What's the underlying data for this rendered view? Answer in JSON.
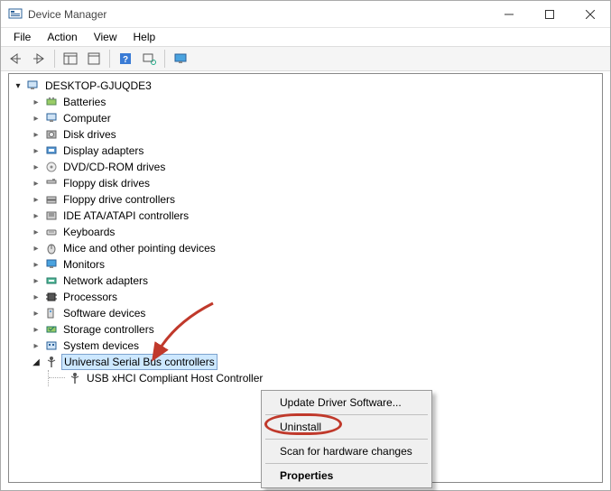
{
  "window": {
    "title": "Device Manager"
  },
  "menubar": [
    "File",
    "Action",
    "View",
    "Help"
  ],
  "tree": {
    "root": "DESKTOP-GJUQDE3",
    "categories": [
      "Batteries",
      "Computer",
      "Disk drives",
      "Display adapters",
      "DVD/CD-ROM drives",
      "Floppy disk drives",
      "Floppy drive controllers",
      "IDE ATA/ATAPI controllers",
      "Keyboards",
      "Mice and other pointing devices",
      "Monitors",
      "Network adapters",
      "Processors",
      "Software devices",
      "Storage controllers",
      "System devices"
    ],
    "selected_category": "Universal Serial Bus controllers",
    "selected_child": "USB xHCI Compliant Host Controller"
  },
  "context_menu": {
    "update": "Update Driver Software...",
    "uninstall": "Uninstall",
    "scan": "Scan for hardware changes",
    "properties": "Properties"
  },
  "annotation": {
    "highlight": "Uninstall"
  }
}
